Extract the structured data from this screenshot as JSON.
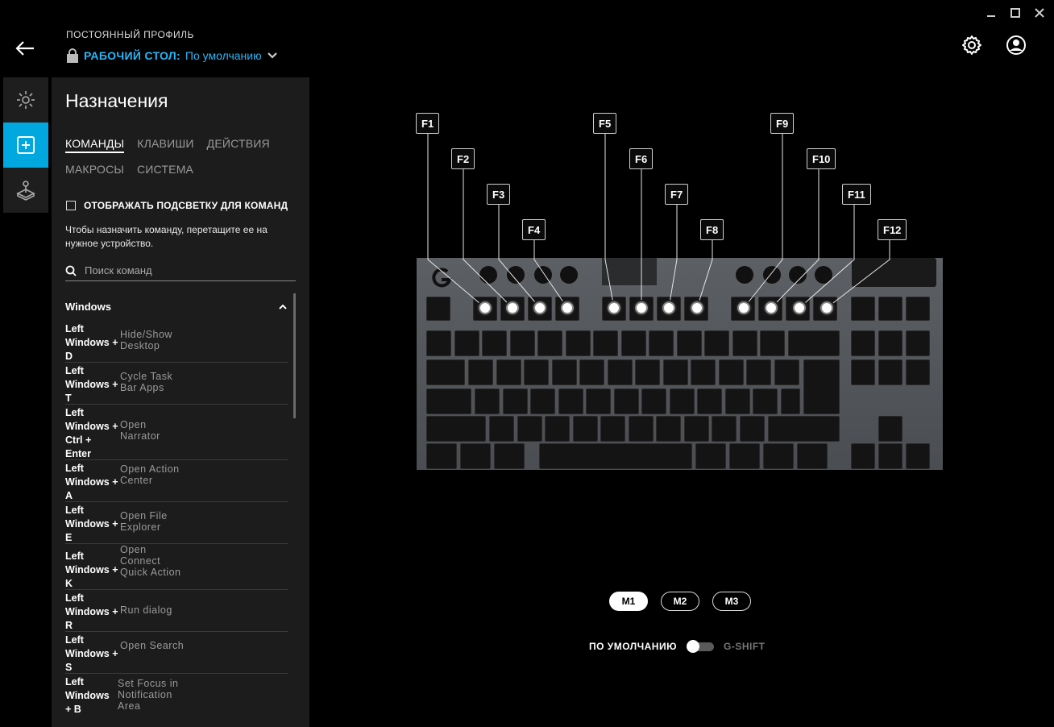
{
  "window": {
    "minimize_icon": "minimize-icon",
    "maximize_icon": "maximize-icon",
    "close_icon": "close-icon"
  },
  "header": {
    "profile_label": "ПОСТОЯННЫЙ ПРОФИЛЬ",
    "profile_name": "РАБОЧИЙ СТОЛ:",
    "profile_value": "По умолчанию"
  },
  "panel": {
    "title": "Назначения",
    "tabs": [
      {
        "label": "КОМАНДЫ",
        "active": true
      },
      {
        "label": "КЛАВИШИ",
        "active": false
      },
      {
        "label": "ДЕЙСТВИЯ",
        "active": false
      },
      {
        "label": "МАКРОСЫ",
        "active": false
      },
      {
        "label": "СИСТЕМА",
        "active": false
      }
    ],
    "show_backlight_label": "ОТОБРАЖАТЬ ПОДСВЕТКУ ДЛЯ КОМАНД",
    "hint": "Чтобы назначить команду, перетащите ее на нужное устройство.",
    "search_placeholder": "Поиск команд",
    "group": "Windows",
    "commands": [
      {
        "keys": "Left\nWindows +\nD",
        "desc": "Hide/Show Desktop"
      },
      {
        "keys": "Left\nWindows +\nT",
        "desc": "Cycle Task Bar Apps"
      },
      {
        "keys": "Left\nWindows +\nCtrl +\nEnter",
        "desc": "Open Narrator"
      },
      {
        "keys": "Left\nWindows +\nA",
        "desc": "Open Action Center"
      },
      {
        "keys": "Left\nWindows +\nE",
        "desc": "Open File Explorer"
      },
      {
        "keys": "Left\nWindows +\nK",
        "desc": "Open Connect Quick Action"
      },
      {
        "keys": "Left\nWindows +\nR",
        "desc": "Run dialog"
      },
      {
        "keys": "Left\nWindows +\nS",
        "desc": "Open Search"
      },
      {
        "keys": "Left\nWindows\n+ B",
        "desc": "Set Focus in Notification Area"
      }
    ]
  },
  "keyboard": {
    "callouts": [
      "F1",
      "F2",
      "F3",
      "F4",
      "F5",
      "F6",
      "F7",
      "F8",
      "F9",
      "F10",
      "F11",
      "F12"
    ]
  },
  "modes": [
    "M1",
    "M2",
    "M3"
  ],
  "active_mode": "M1",
  "toggle": {
    "left_label": "ПО УМОЛЧАНИЮ",
    "right_label": "G-SHIFT",
    "state": "default"
  }
}
